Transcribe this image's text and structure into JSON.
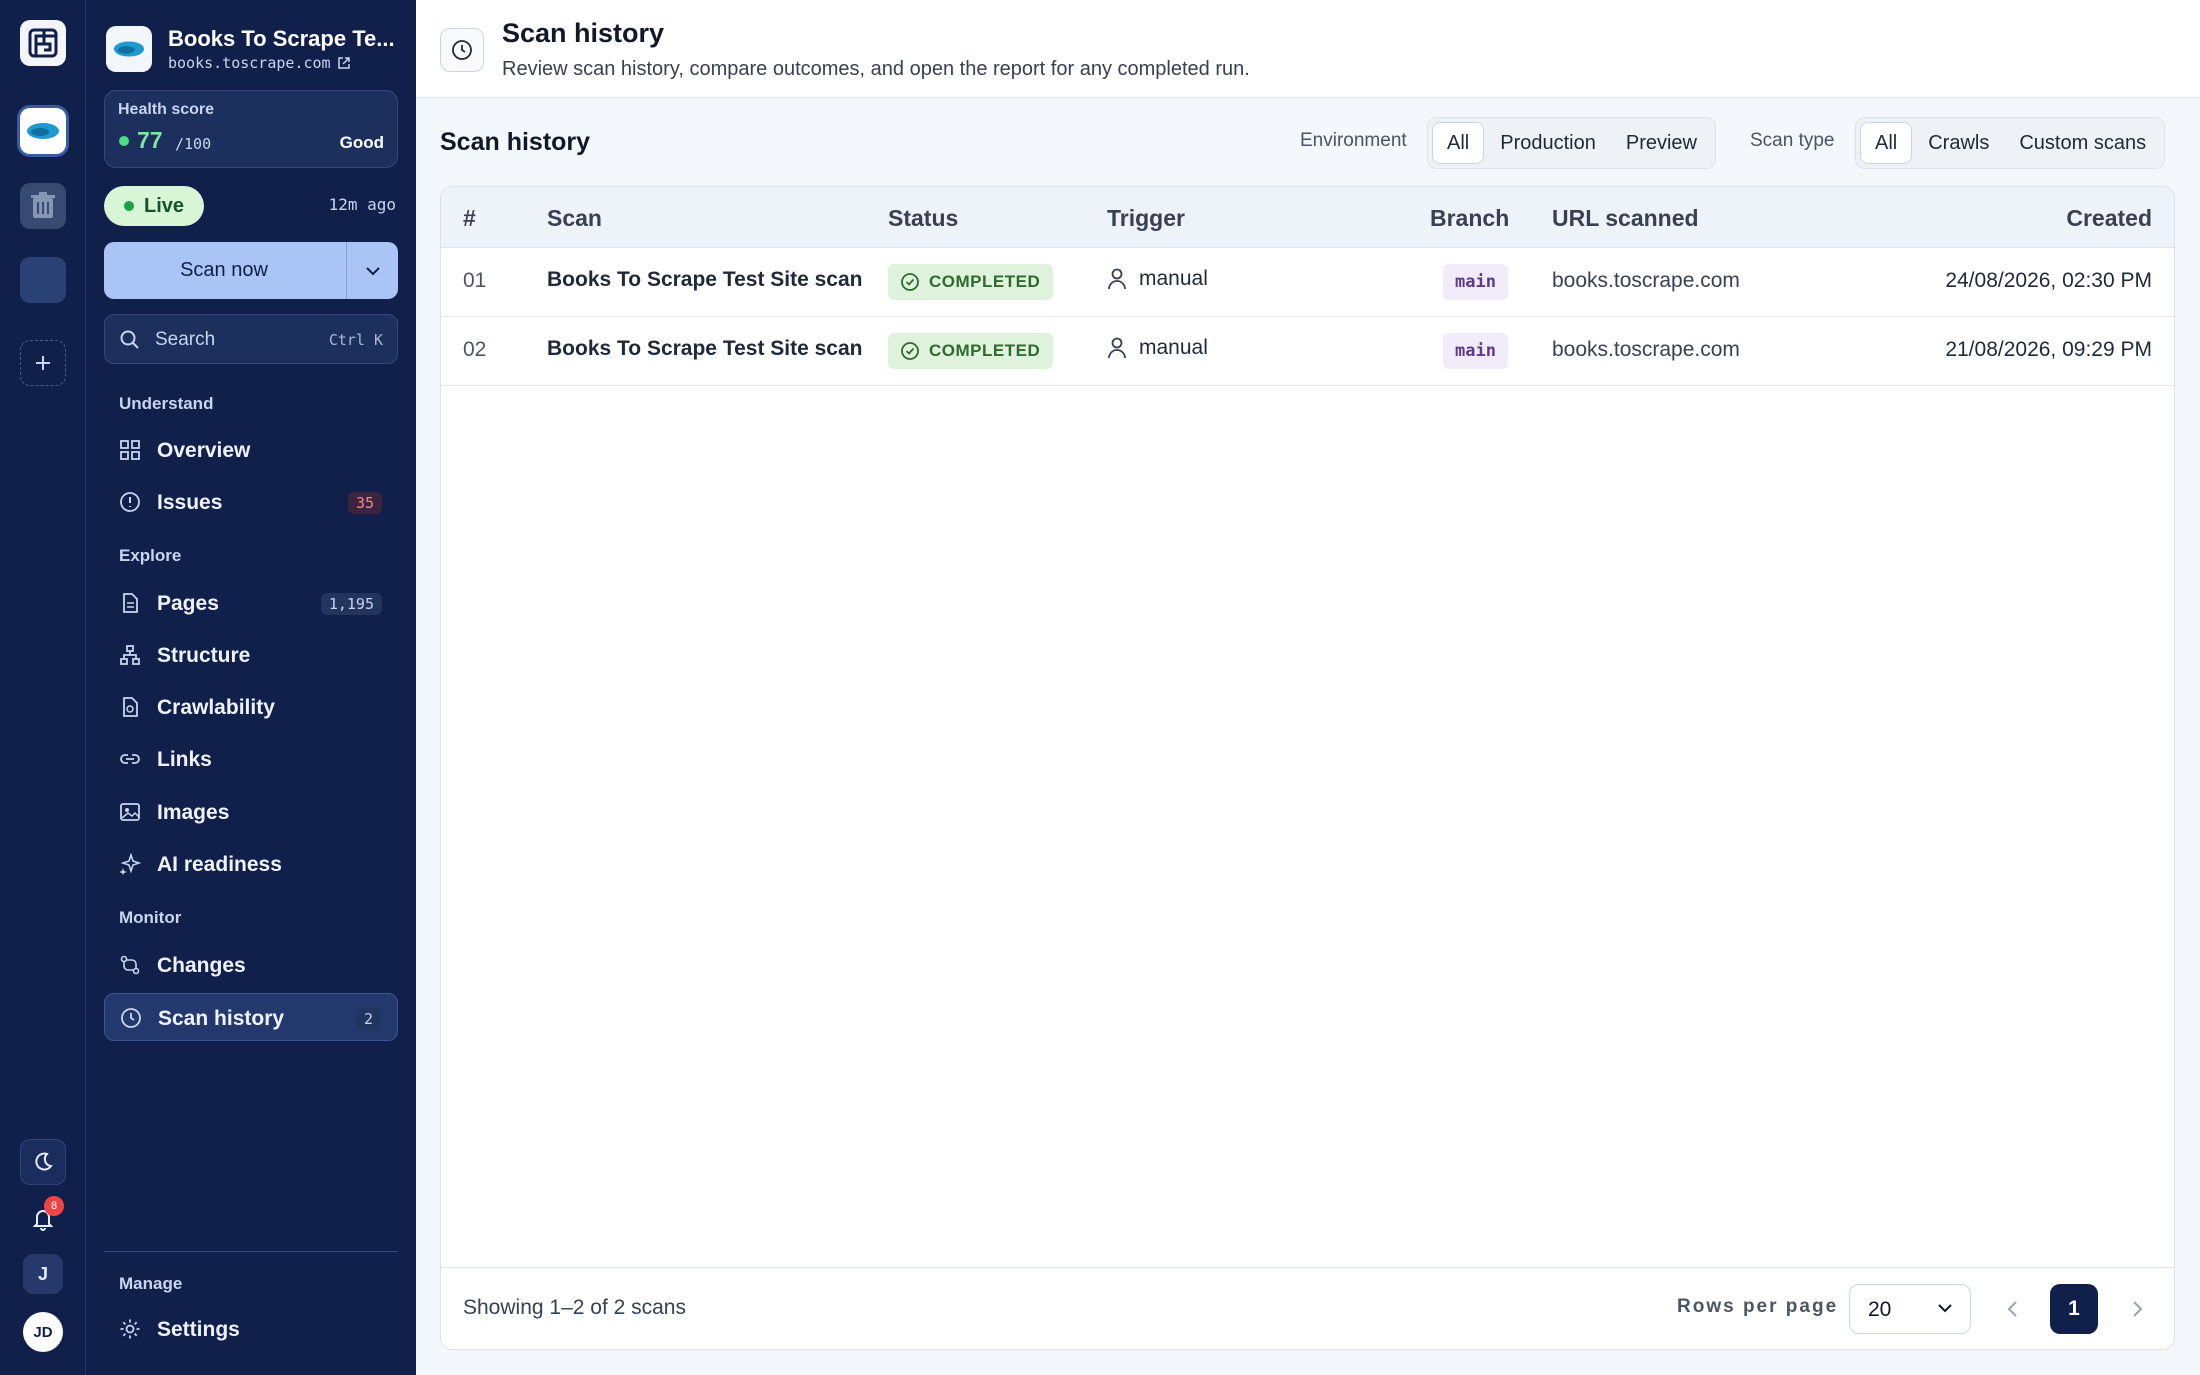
{
  "sidebar": {
    "project_name": "Books To Scrape Te...",
    "project_domain": "books.toscrape.com",
    "health": {
      "label": "Health score",
      "score": "77",
      "max": "/100",
      "grade": "Good"
    },
    "live": {
      "label": "Live",
      "ago": "12m ago"
    },
    "scan_now": "Scan now",
    "search": {
      "placeholder": "Search",
      "shortcut": "Ctrl K"
    },
    "sections": {
      "understand": "Understand",
      "explore": "Explore",
      "monitor": "Monitor",
      "manage": "Manage"
    },
    "items": {
      "overview": {
        "label": "Overview"
      },
      "issues": {
        "label": "Issues",
        "count": "35"
      },
      "pages": {
        "label": "Pages",
        "count": "1,195"
      },
      "structure": {
        "label": "Structure"
      },
      "crawlability": {
        "label": "Crawlability"
      },
      "links": {
        "label": "Links"
      },
      "images": {
        "label": "Images"
      },
      "ai_readiness": {
        "label": "AI readiness"
      },
      "changes": {
        "label": "Changes"
      },
      "scan_history": {
        "label": "Scan history",
        "count": "2"
      },
      "settings": {
        "label": "Settings"
      }
    }
  },
  "rail": {
    "notifications_count": "8",
    "workspace_initial": "J",
    "user_initials": "JD"
  },
  "header": {
    "title": "Scan history",
    "subtitle": "Review scan history, compare outcomes, and open the report for any completed run."
  },
  "content": {
    "title": "Scan history",
    "environment": {
      "label": "Environment",
      "options": [
        "All",
        "Production",
        "Preview"
      ],
      "selected": "All"
    },
    "scan_type": {
      "label": "Scan type",
      "options": [
        "All",
        "Crawls",
        "Custom scans"
      ],
      "selected": "All"
    }
  },
  "table": {
    "columns": [
      "#",
      "Scan",
      "Status",
      "Trigger",
      "Branch",
      "URL scanned",
      "Created"
    ],
    "rows": [
      {
        "num": "01",
        "scan": "Books To Scrape Test Site scan",
        "status": "COMPLETED",
        "trigger": "manual",
        "branch": "main",
        "url": "books.toscrape.com",
        "created": "24/08/2026, 02:30 PM"
      },
      {
        "num": "02",
        "scan": "Books To Scrape Test Site scan",
        "status": "COMPLETED",
        "trigger": "manual",
        "branch": "main",
        "url": "books.toscrape.com",
        "created": "21/08/2026, 09:29 PM"
      }
    ],
    "footer": {
      "showing": "Showing 1–2 of 2 scans",
      "rows_per_page_label": "Rows per page",
      "rows_per_page": "20",
      "current_page": "1"
    }
  },
  "colors": {
    "sidebar_bg": "#10204a",
    "accent_button": "#a9c4f5",
    "status_completed_bg": "#dff3dc",
    "branch_bg": "#f1ebfa"
  }
}
